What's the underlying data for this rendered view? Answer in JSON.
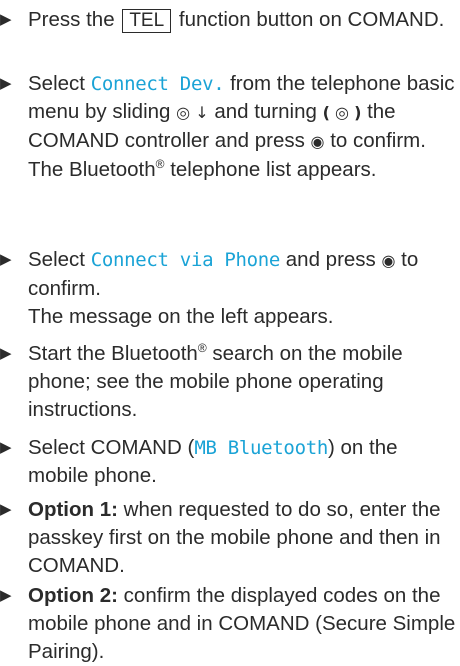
{
  "steps": [
    {
      "a": "Press the",
      "key": "TEL",
      "b": "function button on COMAND."
    },
    {
      "a": "Select",
      "mono": "Connect Dev.",
      "b": "from the telephone basic menu by sliding",
      "c": "and turning",
      "d": "the COMAND controller and press",
      "e": "to confirm.",
      "result_a": "The Bluetooth",
      "reg": "®",
      "result_b": "telephone list appears."
    },
    {
      "a": "Select",
      "mono": "Connect via Phone",
      "b": "and press",
      "c": "to confirm.",
      "result": "The message on the left appears."
    },
    {
      "a": "Start the Bluetooth",
      "reg": "®",
      "b": "search on the mobile phone; see the mobile phone operating instructions."
    },
    {
      "a": "Select COMAND (",
      "mono": "MB Bluetooth",
      "b": ") on the mobile phone."
    },
    {
      "bold": "Option 1:",
      "b": "when requested to do so, enter the passkey first on the mobile phone and then in COMAND."
    },
    {
      "bold": "Option 2:",
      "b": "confirm the displayed codes on the mobile phone and in COMAND (Secure Simple Pairing)."
    }
  ]
}
